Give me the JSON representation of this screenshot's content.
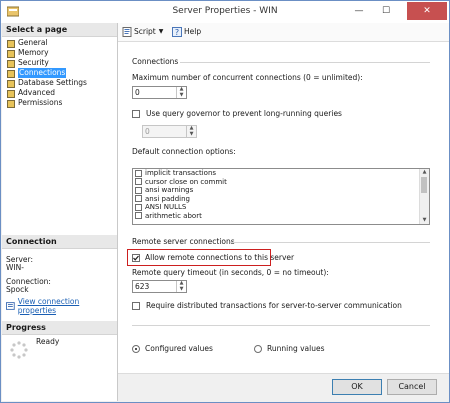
{
  "window": {
    "title": "Server Properties - WIN"
  },
  "left": {
    "select_page_header": "Select a page",
    "pages": [
      "General",
      "Memory",
      "Security",
      "Connections",
      "Database Settings",
      "Advanced",
      "Permissions"
    ],
    "connection_header": "Connection",
    "server_label": "Server:",
    "server_value": "WIN-",
    "connection_label": "Connection:",
    "connection_value": "Spock",
    "view_props_link": "View connection properties",
    "progress_header": "Progress",
    "progress_status": "Ready"
  },
  "toolbar": {
    "script_label": "Script",
    "help_label": "Help"
  },
  "connections": {
    "group_label": "Connections",
    "max_conn_label": "Maximum number of concurrent connections (0 = unlimited):",
    "max_conn_value": "0",
    "governor_label": "Use query governor to prevent long-running queries",
    "governor_value": "0",
    "default_opts_label": "Default connection options:",
    "options": [
      "implicit transactions",
      "cursor close on commit",
      "ansi warnings",
      "ansi padding",
      "ANSI NULLS",
      "arithmetic abort"
    ]
  },
  "remote": {
    "group_label": "Remote server connections",
    "allow_remote_label": "Allow remote connections to this server",
    "timeout_label": "Remote query timeout (in seconds, 0 = no timeout):",
    "timeout_value": "623",
    "distributed_label": "Require distributed transactions for server-to-server communication"
  },
  "values": {
    "configured_label": "Configured values",
    "running_label": "Running values"
  },
  "buttons": {
    "ok": "OK",
    "cancel": "Cancel"
  }
}
